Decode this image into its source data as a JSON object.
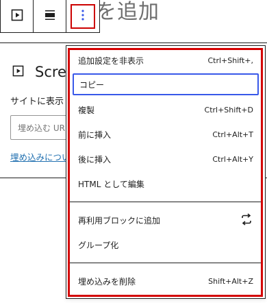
{
  "background": {
    "heading_fragment": "を追加",
    "block": {
      "title": "Scre",
      "description": "サイトに表示",
      "input_placeholder": "埋め込む UR",
      "link_text": "埋め込みについ"
    }
  },
  "toolbar": {
    "buttons": [
      {
        "name": "block-type",
        "icon": "play-square-icon"
      },
      {
        "name": "align",
        "icon": "align-wide-icon"
      },
      {
        "name": "more-options",
        "icon": "vertical-ellipsis-icon",
        "active": true
      }
    ]
  },
  "menu": {
    "groups": [
      [
        {
          "label": "追加設定を非表示",
          "shortcut": "Ctrl+Shift+,"
        },
        {
          "label": "コピー",
          "shortcut": "",
          "focused": true
        },
        {
          "label": "複製",
          "shortcut": "Ctrl+Shift+D"
        },
        {
          "label": "前に挿入",
          "shortcut": "Ctrl+Alt+T"
        },
        {
          "label": "後に挿入",
          "shortcut": "Ctrl+Alt+Y"
        },
        {
          "label": "HTML として編集",
          "shortcut": ""
        }
      ],
      [
        {
          "label": "再利用ブロックに追加",
          "icon": "reusable-block-icon"
        },
        {
          "label": "グループ化",
          "shortcut": ""
        }
      ],
      [
        {
          "label": "埋め込みを削除",
          "shortcut": "Shift+Alt+Z"
        }
      ]
    ]
  },
  "colors": {
    "highlight": "#d40000",
    "focus_ring": "#3858e9",
    "link": "#2271b1"
  }
}
